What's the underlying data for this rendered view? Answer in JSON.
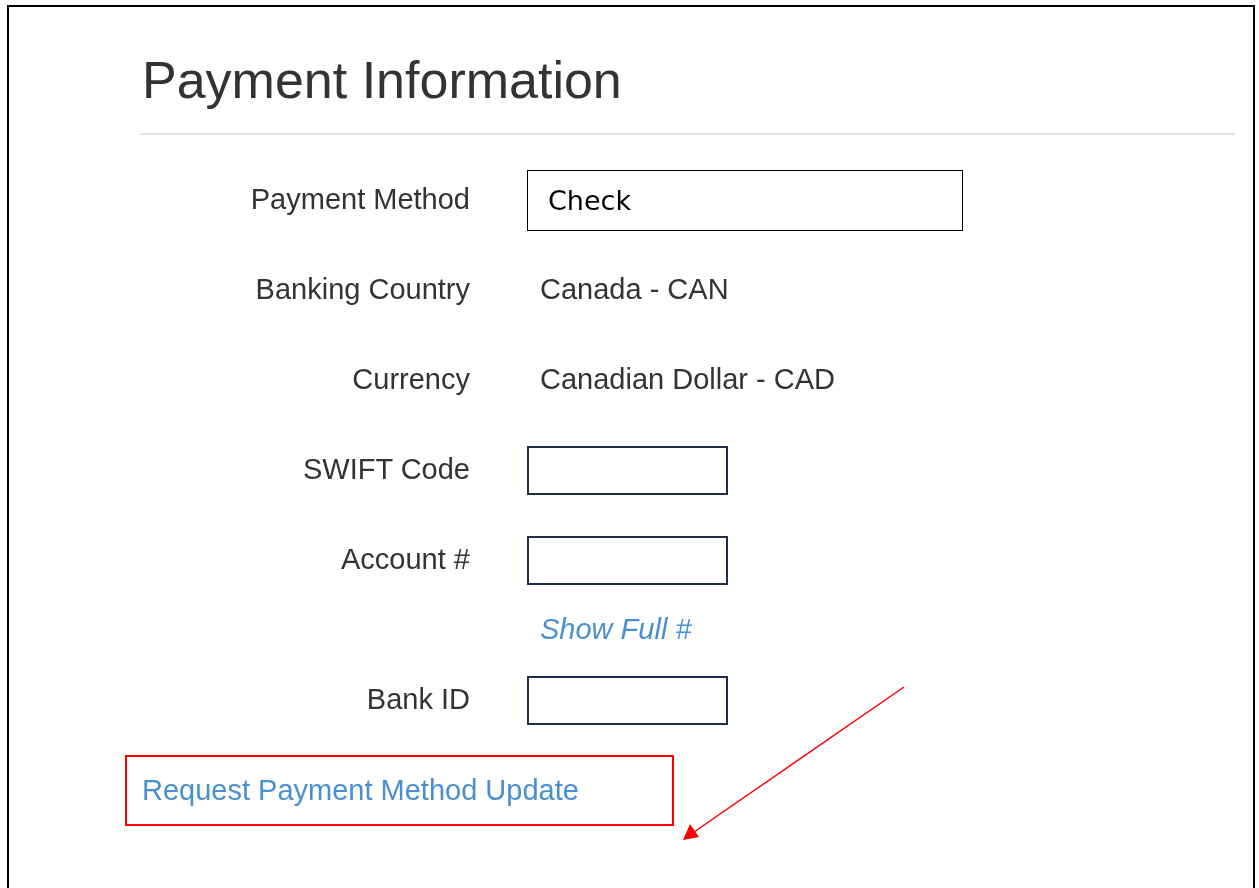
{
  "title": "Payment Information",
  "fields": [
    {
      "kind": "input",
      "label": "Payment Method",
      "value": "Check"
    },
    {
      "kind": "text",
      "label": "Banking Country",
      "value": "Canada - CAN"
    },
    {
      "kind": "text",
      "label": "Currency",
      "value": "Canadian Dollar - CAD"
    },
    {
      "kind": "input",
      "label": "SWIFT Code"
    },
    {
      "kind": "input",
      "label": "Account #"
    },
    {
      "kind": "link",
      "value": "Show Full #"
    },
    {
      "kind": "input",
      "label": "Bank ID"
    }
  ],
  "request_link": "Request Payment Method Update"
}
